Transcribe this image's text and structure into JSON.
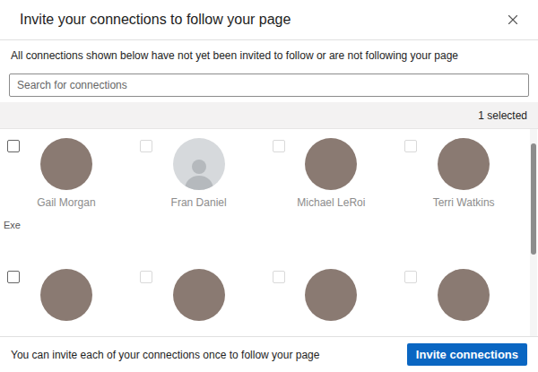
{
  "dialog": {
    "title": "Invite your connections to follow your page",
    "close": "×",
    "subtitle": "All connections shown below have not yet been invited to follow or are not following your page"
  },
  "search": {
    "placeholder": "Search for connections"
  },
  "selection": {
    "count": "1 selected"
  },
  "connections": [
    {
      "name": "Gail Morgan",
      "headline": "Exe",
      "default_avatar": false,
      "checked": false
    },
    {
      "name": "Fran Daniel",
      "default_avatar": true,
      "checked": false
    },
    {
      "name": "Michael LeRoi",
      "default_avatar": false,
      "checked": false
    },
    {
      "name": "Terri Watkins",
      "default_avatar": false,
      "checked": false
    },
    {
      "default_avatar": false,
      "checked": false
    },
    {
      "default_avatar": false,
      "checked": false
    },
    {
      "default_avatar": false,
      "checked": false
    },
    {
      "default_avatar": false,
      "checked": false
    }
  ],
  "footer": {
    "note": "You can invite each of your connections once to follow your page",
    "button": "Invite connections"
  }
}
